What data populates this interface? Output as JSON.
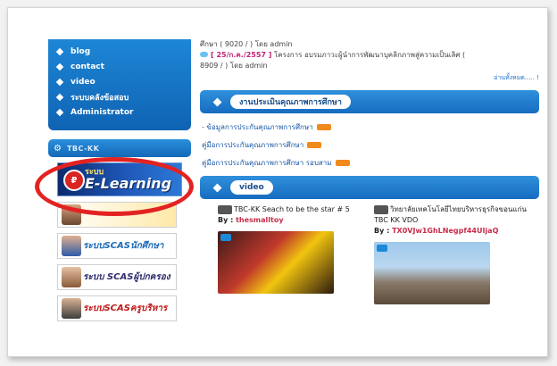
{
  "menu": [
    {
      "label": "blog"
    },
    {
      "label": "contact"
    },
    {
      "label": "video"
    },
    {
      "label": "ระบบคลังข้อสอบ"
    },
    {
      "label": "Administrator"
    }
  ],
  "sidebar_section": {
    "title": "TBC-KK"
  },
  "elearning": {
    "label_small": "ระบบ",
    "label_big": "E-Learning"
  },
  "banners": [
    {
      "label": ""
    },
    {
      "label": "ระบบSCASนักศึกษา"
    },
    {
      "label": "ระบบ SCASผู้ปกครอง"
    },
    {
      "label": "ระบบSCASครูบริหาร"
    }
  ],
  "news": {
    "line1": "ศึกษา ( 9020 / ) โดย admin",
    "date": "[ 25/ก.ค./2557 ]",
    "title": "โครงการ อบรมภาวะผู้นำการพัฒนาบุคลิกภาพสู่ความเป็นเลิศ (",
    "line3": "8909 / ) โดย admin",
    "more": "อ่านทั้งหมด..... !"
  },
  "quality": {
    "title": "งานประเมินคุณภาพการศึกษา",
    "links": [
      "- ข้อมูลการประกันคุณภาพการศึกษา",
      "คู่มือการประกันคุณภาพการศึกษา",
      "คู่มือการประกันคุณภาพการศึกษา รอบสาม"
    ]
  },
  "video": {
    "title": "video",
    "items": [
      {
        "title": "TBC-KK Seach to be the star # 5",
        "by_label": "By :",
        "author": "thesmalltoy"
      },
      {
        "title": "วิทยาลัยเทคโนโลยีไทยบริหารธุรกิจขอนแก่น TBC KK VDO",
        "by_label": "By :",
        "author": "TX0VJw1GhLNegpf44UIjaQ"
      }
    ]
  },
  "colors": {
    "accent": "#1a73c9",
    "highlight": "#e32222"
  }
}
